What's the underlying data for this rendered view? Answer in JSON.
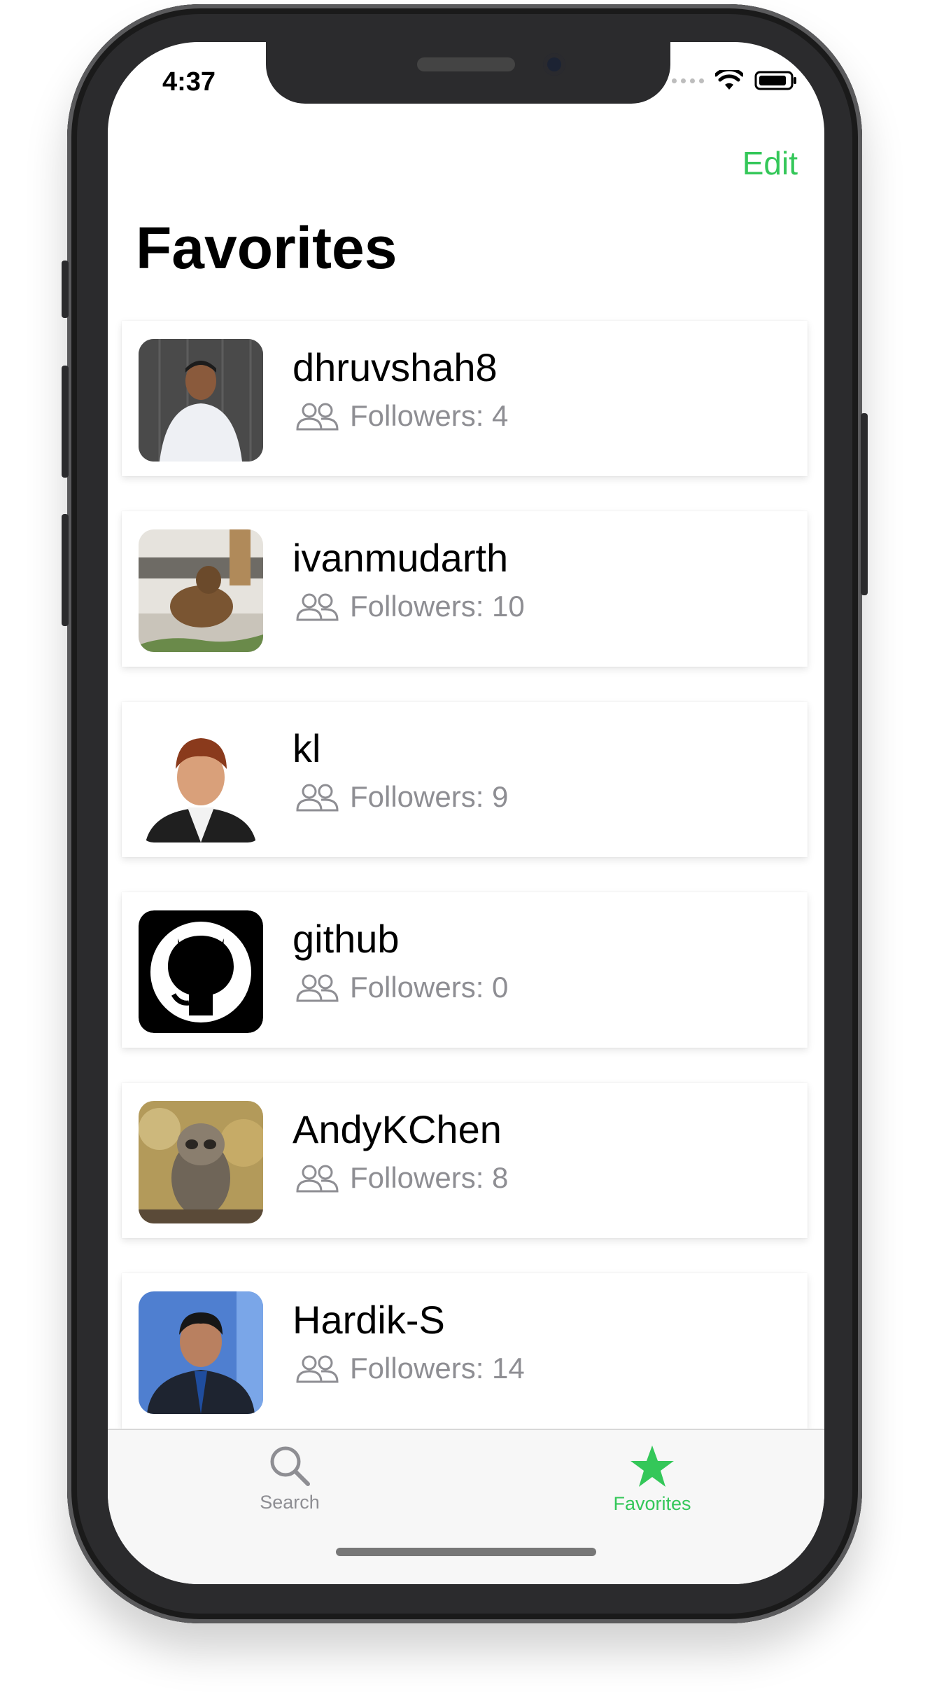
{
  "status_bar": {
    "time": "4:37"
  },
  "nav": {
    "edit_label": "Edit",
    "title": "Favorites"
  },
  "favorites": [
    {
      "username": "dhruvshah8",
      "followers": "Followers: 4"
    },
    {
      "username": "ivanmudarth",
      "followers": "Followers: 10"
    },
    {
      "username": "kl",
      "followers": "Followers: 9"
    },
    {
      "username": "github",
      "followers": "Followers: 0"
    },
    {
      "username": "AndyKChen",
      "followers": "Followers: 8"
    },
    {
      "username": "Hardik-S",
      "followers": "Followers: 14"
    }
  ],
  "tab_bar": {
    "search_label": "Search",
    "favorites_label": "Favorites",
    "active_tab": "Favorites"
  },
  "colors": {
    "accent": "#34c759",
    "secondary_text": "#8e8e93"
  }
}
